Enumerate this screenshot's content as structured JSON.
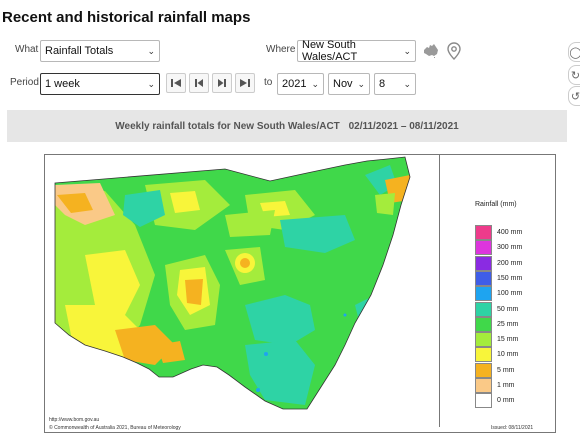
{
  "page": {
    "title": "Recent and historical rainfall maps"
  },
  "controls": {
    "what_label": "What",
    "what_value": "Rainfall Totals",
    "where_label": "Where",
    "where_value": "New South Wales/ACT",
    "period_label": "Period",
    "period_value": "1 week",
    "to_label": "to",
    "year_value": "2021",
    "month_value": "Nov",
    "day_value": "8",
    "nav_buttons": [
      "first-icon",
      "previous-icon",
      "next-icon",
      "last-icon"
    ],
    "icons": [
      "australia-map-icon",
      "location-pin-icon"
    ]
  },
  "caption": {
    "text": "Weekly rainfall totals for New South Wales/ACT",
    "dates": "02/11/2021 – 08/11/2021"
  },
  "map": {
    "source_url": "http://www.bom.gov.au",
    "copyright": "© Commonwealth of Australia 2021, Bureau of Meteorology",
    "issued": "Issued: 08/11/2021",
    "legend": {
      "title": "Rainfall (mm)",
      "items": [
        {
          "label": "400 mm",
          "color": "#ee3b8b"
        },
        {
          "label": "300 mm",
          "color": "#dd35dd"
        },
        {
          "label": "200 mm",
          "color": "#8a2be2"
        },
        {
          "label": "150 mm",
          "color": "#3f5de8"
        },
        {
          "label": "100 mm",
          "color": "#1ea4f0"
        },
        {
          "label": "50 mm",
          "color": "#2ed3a5"
        },
        {
          "label": "25 mm",
          "color": "#40d84a"
        },
        {
          "label": "15 mm",
          "color": "#a4ec3c"
        },
        {
          "label": "10 mm",
          "color": "#f8f53a"
        },
        {
          "label": "5 mm",
          "color": "#f5b220"
        },
        {
          "label": "1 mm",
          "color": "#fac987"
        },
        {
          "label": "0 mm",
          "color": "#ffffff"
        }
      ]
    }
  }
}
